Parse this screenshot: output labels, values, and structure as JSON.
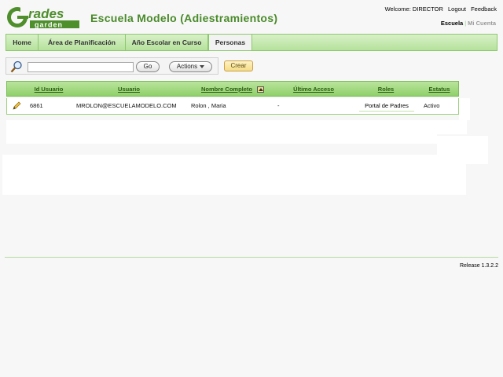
{
  "app": {
    "logo_text_top": "rades",
    "logo_text_bottom": "garden",
    "school_title": "Escuela Modelo (Adiestramientos)"
  },
  "topbar": {
    "welcome": "Welcome: DIRECTOR",
    "logout": "Logout",
    "feedback": "Feedback",
    "account_links": {
      "school": "Escuela",
      "separator": "|",
      "my_account": "Mi Cuenta"
    }
  },
  "nav": {
    "tabs": [
      {
        "label": "Home"
      },
      {
        "label": "Área de Planificación"
      },
      {
        "label": "Año Escolar en Curso"
      },
      {
        "label": "Personas"
      }
    ],
    "active": "Personas"
  },
  "toolbar": {
    "search_value": "",
    "go_label": "Go",
    "actions_label": "Actions",
    "create_label": "Crear"
  },
  "table": {
    "columns": [
      "Id Usuario",
      "Usuario",
      "Nombre Completo",
      "Último Acceso",
      "Roles",
      "Estatus"
    ],
    "rows": [
      {
        "id": "6861",
        "usuario": "MROLON@ESCUELAMODELO.COM",
        "nombre": "Rolon , Maria",
        "ultimo_acceso": "-",
        "roles": "Portal de Padres",
        "estatus": "Activo"
      }
    ]
  },
  "footer": {
    "release": "Release 1.3.2.2"
  },
  "colors": {
    "brand_green": "#4a8a2a",
    "nav_green": "#b5e29b",
    "header_green": "#8fd06a"
  }
}
